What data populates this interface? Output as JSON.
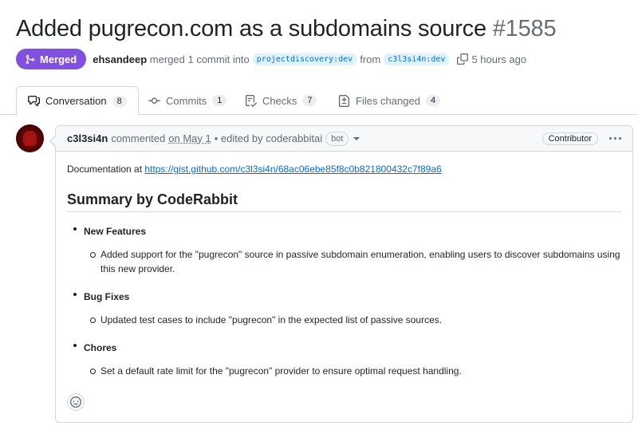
{
  "pr": {
    "title": "Added pugrecon.com as a subdomains source",
    "number": "#1585",
    "state": "Merged",
    "merged_by": "ehsandeep",
    "merge_text": "merged 1 commit into",
    "base_branch": "projectdiscovery:dev",
    "from_text": "from",
    "head_branch": "c3l3si4n:dev",
    "time": "5 hours ago"
  },
  "tabs": [
    {
      "label": "Conversation",
      "count": "8",
      "icon": "comment-discussion-icon"
    },
    {
      "label": "Commits",
      "count": "1",
      "icon": "git-commit-icon"
    },
    {
      "label": "Checks",
      "count": "7",
      "icon": "checklist-icon"
    },
    {
      "label": "Files changed",
      "count": "4",
      "icon": "file-diff-icon"
    }
  ],
  "comment": {
    "author": "c3l3si4n",
    "commented": "commented",
    "date": "on May 1",
    "edited": "• edited by coderabbitai",
    "bot_label": "bot",
    "role": "Contributor",
    "doc_prefix": "Documentation at",
    "doc_link": "https://gist.github.com/c3l3si4n/68ac06ebe85f8c0b821800432c7f89a6",
    "summary_heading": "Summary by CodeRabbit",
    "sections": [
      {
        "head": "New Features",
        "item": "Added support for the \"pugrecon\" source in passive subdomain enumeration, enabling users to discover subdomains using this new provider."
      },
      {
        "head": "Bug Fixes",
        "item": "Updated test cases to include \"pugrecon\" in the expected list of passive sources."
      },
      {
        "head": "Chores",
        "item": "Set a default rate limit for the \"pugrecon\" provider to ensure optimal request handling."
      }
    ]
  },
  "colors": {
    "merged_purple": "#8250df",
    "link_blue": "#0969da",
    "muted": "#656d76",
    "border": "#d0d7de"
  }
}
